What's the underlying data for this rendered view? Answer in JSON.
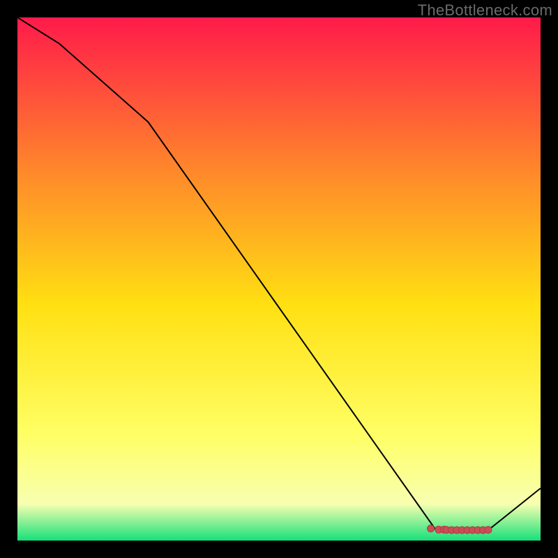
{
  "watermark": "TheBottleneck.com",
  "colors": {
    "bg": "#000000",
    "line": "#000000",
    "marker": "#c94f56",
    "marker_outline": "#b23a42",
    "watermark": "#6b6b6b",
    "grad_top": "#ff1a4a",
    "grad_q1": "#ff8a2a",
    "grad_mid": "#ffe012",
    "grad_q3": "#ffff66",
    "grad_low": "#f7ffb0",
    "grad_bottom": "#17e07a"
  },
  "chart_data": {
    "type": "line",
    "title": "",
    "xlabel": "",
    "ylabel": "",
    "xlim": [
      0,
      100
    ],
    "ylim": [
      0,
      100
    ],
    "series": [
      {
        "name": "curve",
        "x": [
          0,
          8,
          25,
          80,
          90,
          100
        ],
        "y": [
          100,
          95,
          80,
          2,
          2,
          10
        ]
      }
    ],
    "markers": {
      "name": "highlight-cluster",
      "x": [
        79,
        80.5,
        81.5,
        82,
        83,
        84,
        85,
        86,
        87,
        88,
        89,
        90
      ],
      "y": [
        2.3,
        2.1,
        2.1,
        2.05,
        2.0,
        2.0,
        2.0,
        2.0,
        2.0,
        2.0,
        2.0,
        2.05
      ]
    }
  }
}
